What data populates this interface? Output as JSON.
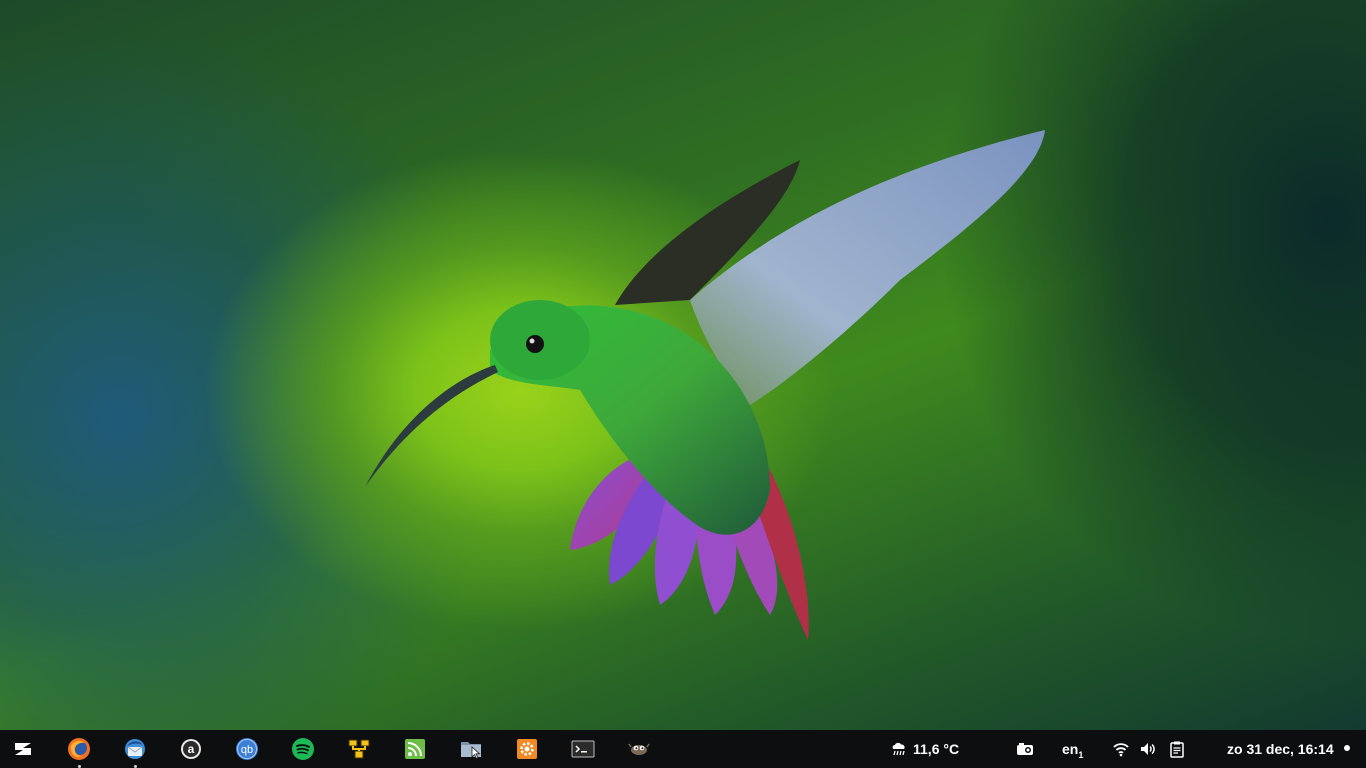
{
  "desktop": {
    "wallpaper": "hummingbird-wallpaper"
  },
  "taskbar": {
    "launchers": [
      {
        "name": "zorin-menu-icon",
        "running": false
      },
      {
        "name": "firefox-icon",
        "running": true
      },
      {
        "name": "thunderbird-icon",
        "running": true
      },
      {
        "name": "amarok-icon",
        "running": false
      },
      {
        "name": "qbittorrent-icon",
        "label": "qb",
        "running": false
      },
      {
        "name": "spotify-icon",
        "running": false
      },
      {
        "name": "network-app-icon",
        "running": false
      },
      {
        "name": "rss-reader-icon",
        "running": false
      },
      {
        "name": "file-manager-icon",
        "running": false
      },
      {
        "name": "settings-app-icon",
        "running": false
      },
      {
        "name": "terminal-icon",
        "running": false
      },
      {
        "name": "gimp-icon",
        "running": false
      }
    ],
    "tray": {
      "weather_icon": "rain-cloud-icon",
      "temperature": "11,6 °C",
      "keyboard_layout": "en",
      "keyboard_layout_sub": "1",
      "datetime": "zo 31 dec, 16:14"
    }
  },
  "colors": {
    "taskbar_bg": "#0c0e10",
    "firefox_orange": "#f37021",
    "qbittorrent_blue": "#3e7fd6",
    "spotify_green": "#1db954",
    "rss_green": "#6cbe45",
    "settings_orange": "#f08a24"
  }
}
